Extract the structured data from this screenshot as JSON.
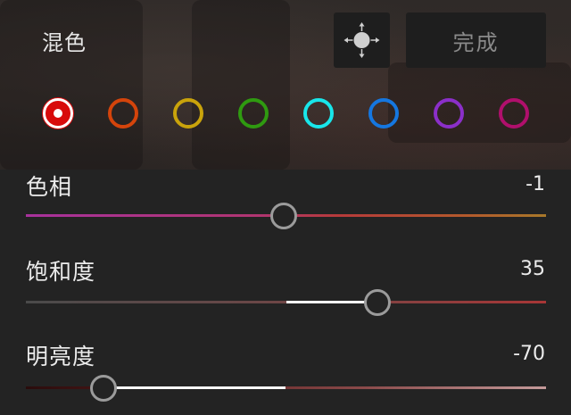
{
  "header": {
    "title": "混色",
    "done_label": "完成",
    "target_icon": "target-move-icon"
  },
  "swatches": [
    {
      "name": "red",
      "color": "#d80b0b",
      "selected": true
    },
    {
      "name": "orange",
      "color": "#d4440b",
      "selected": false
    },
    {
      "name": "yellow",
      "color": "#c9a30b",
      "selected": false
    },
    {
      "name": "green",
      "color": "#2f9a10",
      "selected": false
    },
    {
      "name": "aqua",
      "color": "#18e6ea",
      "selected": false
    },
    {
      "name": "blue",
      "color": "#1577e0",
      "selected": false
    },
    {
      "name": "purple",
      "color": "#8b2fc9",
      "selected": false
    },
    {
      "name": "magenta",
      "color": "#b00f6c",
      "selected": false
    }
  ],
  "sliders": {
    "hue": {
      "label": "色相",
      "value": "-1",
      "min": -100,
      "max": 100
    },
    "saturation": {
      "label": "饱和度",
      "value": "35",
      "min": -100,
      "max": 100
    },
    "luminance": {
      "label": "明亮度",
      "value": "-70",
      "min": -100,
      "max": 100
    }
  }
}
